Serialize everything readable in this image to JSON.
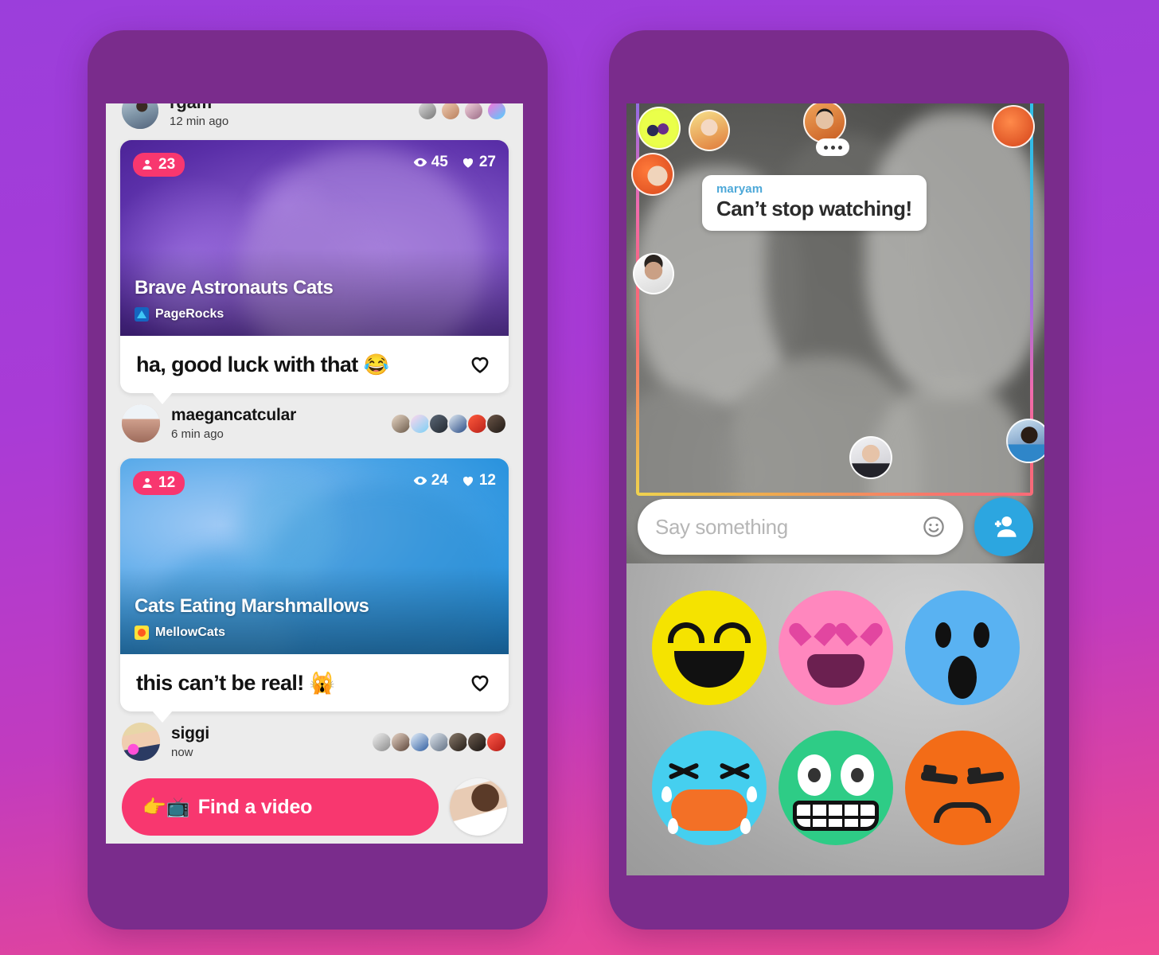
{
  "theme": {
    "bg_gradient_start": "#9B3EDB",
    "bg_gradient_end": "#EF4A93",
    "phone_frame": "#7A2C8C",
    "accent_pink": "#F8376F",
    "accent_blue": "#2CA6E0",
    "screen_bg": "#ECECEC"
  },
  "left_phone": {
    "top_post": {
      "username": "rgam",
      "time": "12 min ago",
      "viewer_count": 4
    },
    "posts": [
      {
        "live_viewers": "23",
        "views": "45",
        "likes": "27",
        "title": "Brave Astronauts Cats",
        "channel": "PageRocks",
        "channel_icon": "triangle-icon",
        "comment": "ha, good luck with that",
        "comment_emoji": "😂",
        "like_icon": "heart-outline-icon",
        "commenter": "maegancatcular",
        "commenter_time": "6 min ago",
        "reactor_count": 6
      },
      {
        "live_viewers": "12",
        "views": "24",
        "likes": "12",
        "title": "Cats Eating Marshmallows",
        "channel": "MellowCats",
        "channel_icon": "square-dot-icon",
        "comment": "this can’t be real!",
        "comment_emoji": "🙀",
        "like_icon": "heart-outline-icon",
        "commenter": "siggi",
        "commenter_time": "now",
        "reactor_count": 7
      }
    ],
    "find_button": {
      "lead_emoji": "👉📺",
      "label": "Find a video",
      "color": "#F8376F"
    },
    "my_avatar": "user-avatar"
  },
  "right_phone": {
    "video": {
      "chat_bubble": {
        "name": "maryam",
        "message": "Can’t stop watching!"
      },
      "typing_indicator": "typing-dots-icon",
      "participant_count": 8
    },
    "composer": {
      "placeholder": "Say something",
      "value": "",
      "emoji_button": "smiley-face-icon",
      "add_friend_button": "add-person-icon",
      "add_friend_color": "#2CA6E0"
    },
    "reactions": [
      {
        "name": "laughing",
        "label": "😄",
        "color": "#F5E300"
      },
      {
        "name": "heart-eyes",
        "label": "😍",
        "color": "#FF87BE"
      },
      {
        "name": "shocked",
        "label": "😮",
        "color": "#59B2F2"
      },
      {
        "name": "crying",
        "label": "😭",
        "color": "#45CFEF"
      },
      {
        "name": "grimacing",
        "label": "😬",
        "color": "#2ECC86"
      },
      {
        "name": "annoyed",
        "label": "😒",
        "color": "#F36C17"
      }
    ]
  }
}
